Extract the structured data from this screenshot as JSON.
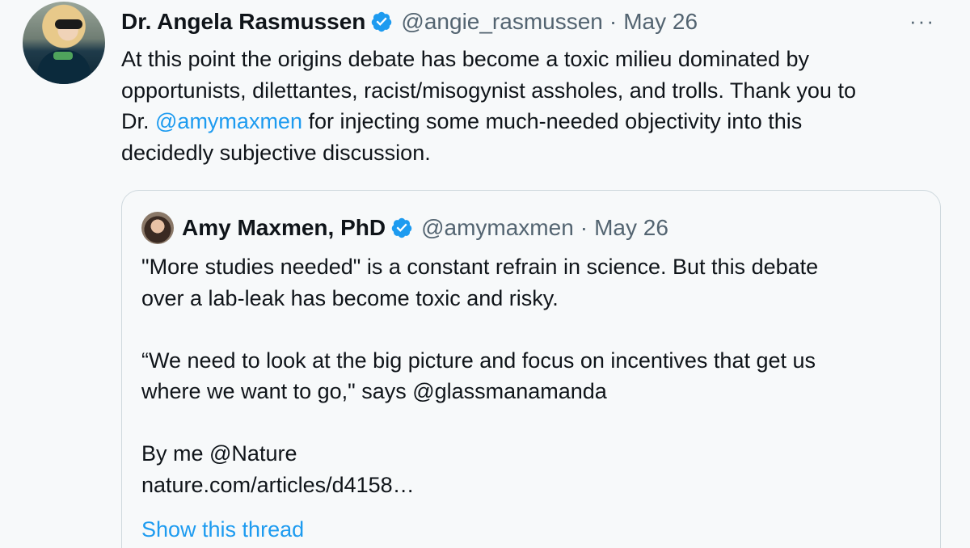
{
  "tweet": {
    "author_name": "Dr. Angela Rasmussen",
    "handle": "@angie_rasmussen",
    "separator": "·",
    "date": "May 26",
    "more_icon": "···",
    "text_lines": [
      "At this point the origins debate has become a toxic milieu dominated by",
      "opportunists, dilettantes, racist/misogynist assholes, and trolls. Thank you to"
    ],
    "text_line3_prefix": "Dr. ",
    "text_mention": "@amymaxmen",
    "text_line3_suffix": " for injecting some much-needed objectivity into this",
    "text_line4": "decidedly subjective discussion.",
    "verified_icon": "verified-badge-icon",
    "accent_color": "#1d9bf0"
  },
  "quoted": {
    "author_name": "Amy Maxmen, PhD",
    "handle": "@amymaxmen",
    "separator": "·",
    "date": "May 26",
    "line1": "\"More studies needed\" is a constant refrain in science. But this debate",
    "line2": "over a lab-leak has become toxic and risky.",
    "line3": "“We need to look at the big picture and focus on incentives that get us",
    "line4": "where we want to go,\" says @glassmanamanda",
    "line5": "By me @Nature",
    "line6": "nature.com/articles/d4158…",
    "show_thread": "Show this thread"
  }
}
